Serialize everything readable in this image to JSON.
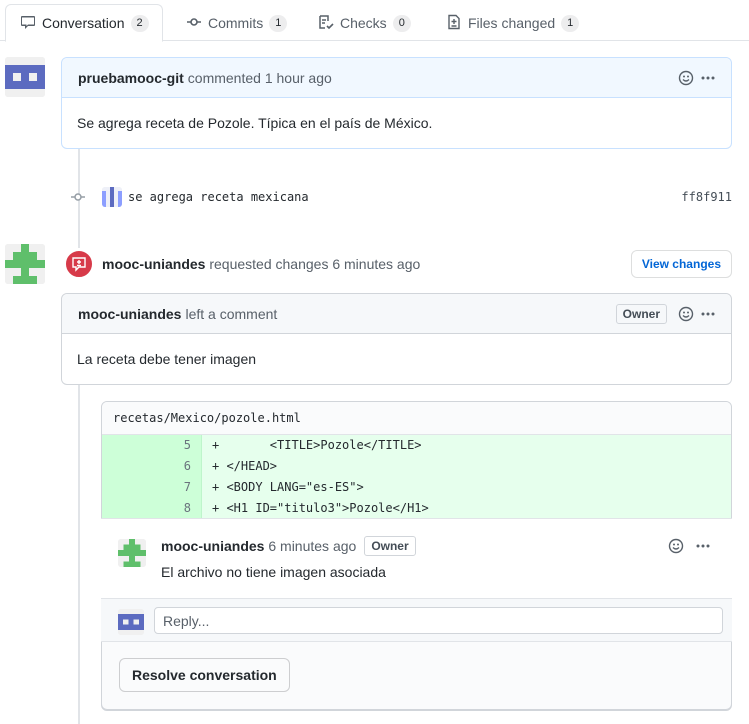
{
  "tabs": [
    {
      "label": "Conversation",
      "count": "2",
      "icon": "comment-icon"
    },
    {
      "label": "Commits",
      "count": "1",
      "icon": "git-commit-icon"
    },
    {
      "label": "Checks",
      "count": "0",
      "icon": "checklist-icon"
    },
    {
      "label": "Files changed",
      "count": "1",
      "icon": "file-diff-icon"
    }
  ],
  "comment1": {
    "author": "pruebamooc-git",
    "action": "commented",
    "time": "1 hour ago",
    "body": "Se agrega receta de Pozole. Típica en el país de México."
  },
  "commit": {
    "message": "se agrega receta mexicana",
    "sha": "ff8f911"
  },
  "review": {
    "author": "mooc-uniandes",
    "action": "requested changes",
    "time": "6 minutes ago",
    "view_changes": "View changes"
  },
  "review_comment": {
    "author": "mooc-uniandes",
    "action": "left a comment",
    "owner_badge": "Owner",
    "body": "La receta debe tener imagen"
  },
  "code": {
    "file": "recetas/Mexico/pozole.html",
    "lines": [
      {
        "num": "5",
        "text": "+       <TITLE>Pozole</TITLE>"
      },
      {
        "num": "6",
        "text": "+ </HEAD>"
      },
      {
        "num": "7",
        "text": "+ <BODY LANG=\"es-ES\">"
      },
      {
        "num": "8",
        "text": "+ <H1 ID=\"titulo3\">Pozole</H1>"
      }
    ]
  },
  "thread_comment": {
    "author": "mooc-uniandes",
    "time": "6 minutes ago",
    "owner_badge": "Owner",
    "body": "El archivo no tiene imagen asociada"
  },
  "reply": {
    "placeholder": "Reply..."
  },
  "resolve_label": "Resolve conversation",
  "colors": {
    "accent": "#0366d6",
    "added_bg": "#e6ffed",
    "request_changes": "#d73a49",
    "avatar_blue": "#5c6bc0",
    "avatar_green": "#5fbf6b"
  }
}
